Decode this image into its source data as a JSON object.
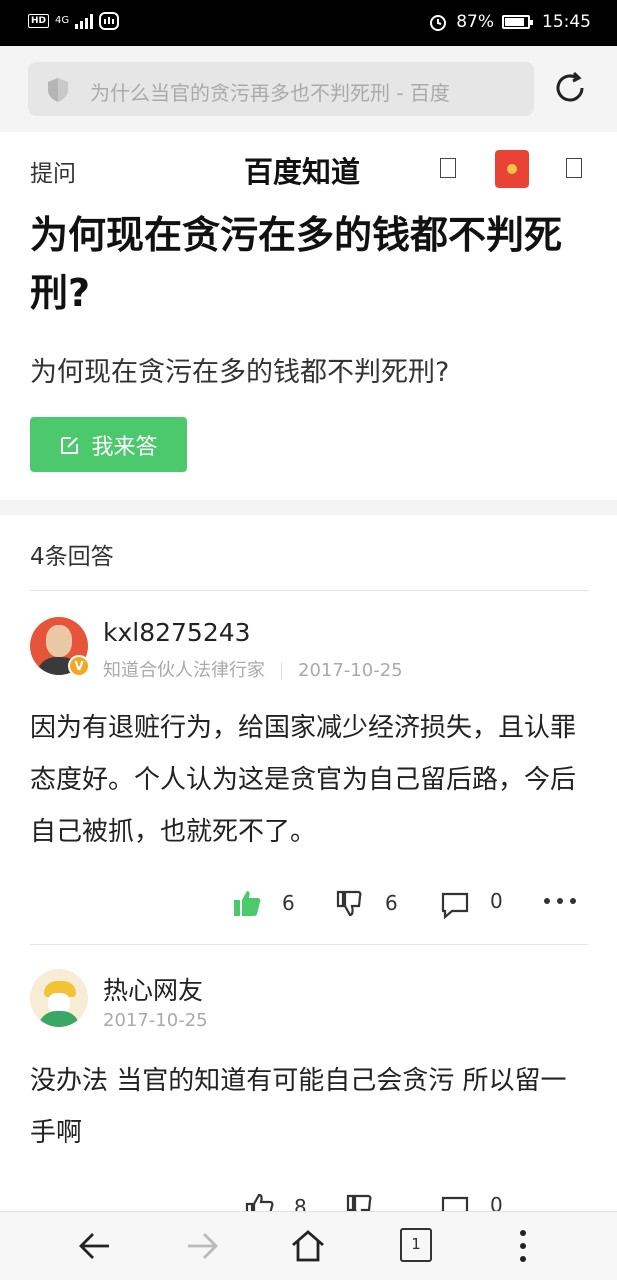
{
  "status": {
    "network": "4G",
    "battery": "87%",
    "battery_level": 0.87,
    "time": "15:45"
  },
  "browser": {
    "url_text": "为什么当官的贪污再多也不判死刑 - 百度"
  },
  "header": {
    "ask_label": "提问",
    "brand": "百度知道"
  },
  "question": {
    "title": "为何现在贪污在多的钱都不判死刑?",
    "description": "为何现在贪污在多的钱都不判死刑?",
    "answer_button": "我来答"
  },
  "answers_count": "4条回答",
  "answers": [
    {
      "username": "kxl8275243",
      "badge": "V",
      "role": "知道合伙人法律行家",
      "date": "2017-10-25",
      "text": "因为有退赃行为，给国家减少经济损失，且认罪态度好。个人认为这是贪官为自己留后路，今后自己被抓，也就死不了。",
      "likes": "6",
      "dislikes": "6",
      "comments": "0"
    },
    {
      "username": "热心网友",
      "date": "2017-10-25",
      "text": "没办法 当官的知道有可能自己会贪污 所以留一手啊",
      "likes": "8",
      "comments": "0"
    }
  ],
  "icons": {
    "like": "thumbs-up-icon",
    "dislike": "thumbs-down-icon",
    "comment": "comment-icon",
    "more": "more-icon"
  },
  "colors": {
    "accent_green": "#4bc96c",
    "redpack": "#e94335"
  },
  "navbar": {
    "tabs_count": "1"
  }
}
